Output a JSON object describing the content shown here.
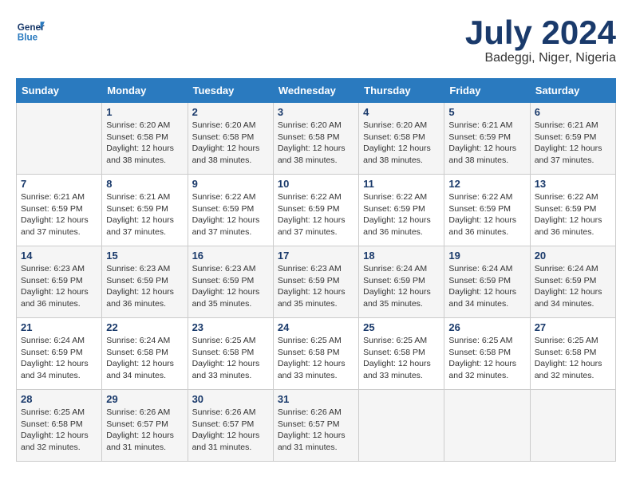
{
  "header": {
    "logo_line1": "General",
    "logo_line2": "Blue",
    "month": "July 2024",
    "location": "Badeggi, Niger, Nigeria"
  },
  "days_of_week": [
    "Sunday",
    "Monday",
    "Tuesday",
    "Wednesday",
    "Thursday",
    "Friday",
    "Saturday"
  ],
  "weeks": [
    [
      {
        "num": "",
        "info": ""
      },
      {
        "num": "1",
        "info": "Sunrise: 6:20 AM\nSunset: 6:58 PM\nDaylight: 12 hours\nand 38 minutes."
      },
      {
        "num": "2",
        "info": "Sunrise: 6:20 AM\nSunset: 6:58 PM\nDaylight: 12 hours\nand 38 minutes."
      },
      {
        "num": "3",
        "info": "Sunrise: 6:20 AM\nSunset: 6:58 PM\nDaylight: 12 hours\nand 38 minutes."
      },
      {
        "num": "4",
        "info": "Sunrise: 6:20 AM\nSunset: 6:58 PM\nDaylight: 12 hours\nand 38 minutes."
      },
      {
        "num": "5",
        "info": "Sunrise: 6:21 AM\nSunset: 6:59 PM\nDaylight: 12 hours\nand 38 minutes."
      },
      {
        "num": "6",
        "info": "Sunrise: 6:21 AM\nSunset: 6:59 PM\nDaylight: 12 hours\nand 37 minutes."
      }
    ],
    [
      {
        "num": "7",
        "info": "Sunrise: 6:21 AM\nSunset: 6:59 PM\nDaylight: 12 hours\nand 37 minutes."
      },
      {
        "num": "8",
        "info": "Sunrise: 6:21 AM\nSunset: 6:59 PM\nDaylight: 12 hours\nand 37 minutes."
      },
      {
        "num": "9",
        "info": "Sunrise: 6:22 AM\nSunset: 6:59 PM\nDaylight: 12 hours\nand 37 minutes."
      },
      {
        "num": "10",
        "info": "Sunrise: 6:22 AM\nSunset: 6:59 PM\nDaylight: 12 hours\nand 37 minutes."
      },
      {
        "num": "11",
        "info": "Sunrise: 6:22 AM\nSunset: 6:59 PM\nDaylight: 12 hours\nand 36 minutes."
      },
      {
        "num": "12",
        "info": "Sunrise: 6:22 AM\nSunset: 6:59 PM\nDaylight: 12 hours\nand 36 minutes."
      },
      {
        "num": "13",
        "info": "Sunrise: 6:22 AM\nSunset: 6:59 PM\nDaylight: 12 hours\nand 36 minutes."
      }
    ],
    [
      {
        "num": "14",
        "info": "Sunrise: 6:23 AM\nSunset: 6:59 PM\nDaylight: 12 hours\nand 36 minutes."
      },
      {
        "num": "15",
        "info": "Sunrise: 6:23 AM\nSunset: 6:59 PM\nDaylight: 12 hours\nand 36 minutes."
      },
      {
        "num": "16",
        "info": "Sunrise: 6:23 AM\nSunset: 6:59 PM\nDaylight: 12 hours\nand 35 minutes."
      },
      {
        "num": "17",
        "info": "Sunrise: 6:23 AM\nSunset: 6:59 PM\nDaylight: 12 hours\nand 35 minutes."
      },
      {
        "num": "18",
        "info": "Sunrise: 6:24 AM\nSunset: 6:59 PM\nDaylight: 12 hours\nand 35 minutes."
      },
      {
        "num": "19",
        "info": "Sunrise: 6:24 AM\nSunset: 6:59 PM\nDaylight: 12 hours\nand 34 minutes."
      },
      {
        "num": "20",
        "info": "Sunrise: 6:24 AM\nSunset: 6:59 PM\nDaylight: 12 hours\nand 34 minutes."
      }
    ],
    [
      {
        "num": "21",
        "info": "Sunrise: 6:24 AM\nSunset: 6:59 PM\nDaylight: 12 hours\nand 34 minutes."
      },
      {
        "num": "22",
        "info": "Sunrise: 6:24 AM\nSunset: 6:58 PM\nDaylight: 12 hours\nand 34 minutes."
      },
      {
        "num": "23",
        "info": "Sunrise: 6:25 AM\nSunset: 6:58 PM\nDaylight: 12 hours\nand 33 minutes."
      },
      {
        "num": "24",
        "info": "Sunrise: 6:25 AM\nSunset: 6:58 PM\nDaylight: 12 hours\nand 33 minutes."
      },
      {
        "num": "25",
        "info": "Sunrise: 6:25 AM\nSunset: 6:58 PM\nDaylight: 12 hours\nand 33 minutes."
      },
      {
        "num": "26",
        "info": "Sunrise: 6:25 AM\nSunset: 6:58 PM\nDaylight: 12 hours\nand 32 minutes."
      },
      {
        "num": "27",
        "info": "Sunrise: 6:25 AM\nSunset: 6:58 PM\nDaylight: 12 hours\nand 32 minutes."
      }
    ],
    [
      {
        "num": "28",
        "info": "Sunrise: 6:25 AM\nSunset: 6:58 PM\nDaylight: 12 hours\nand 32 minutes."
      },
      {
        "num": "29",
        "info": "Sunrise: 6:26 AM\nSunset: 6:57 PM\nDaylight: 12 hours\nand 31 minutes."
      },
      {
        "num": "30",
        "info": "Sunrise: 6:26 AM\nSunset: 6:57 PM\nDaylight: 12 hours\nand 31 minutes."
      },
      {
        "num": "31",
        "info": "Sunrise: 6:26 AM\nSunset: 6:57 PM\nDaylight: 12 hours\nand 31 minutes."
      },
      {
        "num": "",
        "info": ""
      },
      {
        "num": "",
        "info": ""
      },
      {
        "num": "",
        "info": ""
      }
    ]
  ]
}
